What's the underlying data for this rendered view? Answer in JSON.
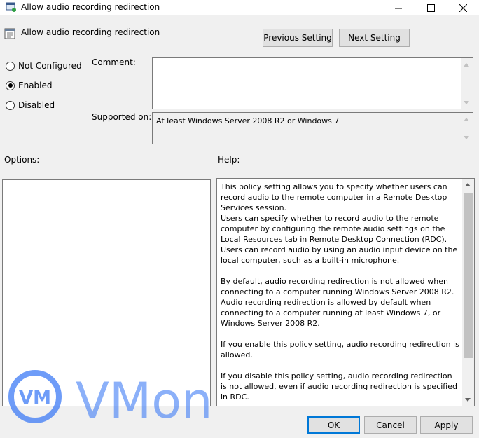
{
  "window": {
    "title": "Allow audio recording redirection",
    "minimize_icon": "minimize-icon",
    "maximize_icon": "maximize-icon",
    "close_icon": "close-icon"
  },
  "header": {
    "policy_name": "Allow audio recording redirection",
    "prev_button": "Previous Setting",
    "next_button": "Next Setting"
  },
  "state": {
    "options": [
      {
        "label": "Not Configured",
        "selected": false
      },
      {
        "label": "Enabled",
        "selected": true
      },
      {
        "label": "Disabled",
        "selected": false
      }
    ]
  },
  "comment": {
    "label": "Comment:",
    "value": ""
  },
  "supported": {
    "label": "Supported on:",
    "value": "At least Windows Server 2008 R2 or Windows 7"
  },
  "options_label": "Options:",
  "help": {
    "label": "Help:",
    "paragraphs": [
      "This policy setting allows you to specify whether users can record audio to the remote computer in a Remote Desktop Services session.",
      "Users can specify whether to record audio to the remote computer by configuring the remote audio settings on the Local Resources tab in Remote Desktop Connection (RDC). Users can record audio by using an audio input device on the local computer, such as a built-in microphone.",
      "By default, audio recording redirection is not allowed when connecting to a computer running Windows Server 2008 R2. Audio recording redirection is allowed by default when connecting to a computer running at least Windows 7, or Windows Server 2008 R2.",
      "If you enable this policy setting, audio recording redirection is allowed.",
      "If you disable this policy setting, audio recording redirection is not allowed, even if audio recording redirection is specified in RDC."
    ]
  },
  "footer": {
    "ok": "OK",
    "cancel": "Cancel",
    "apply": "Apply"
  },
  "watermark": {
    "badge": "VM",
    "text": "VMon",
    "color": "#3d7bf5"
  }
}
